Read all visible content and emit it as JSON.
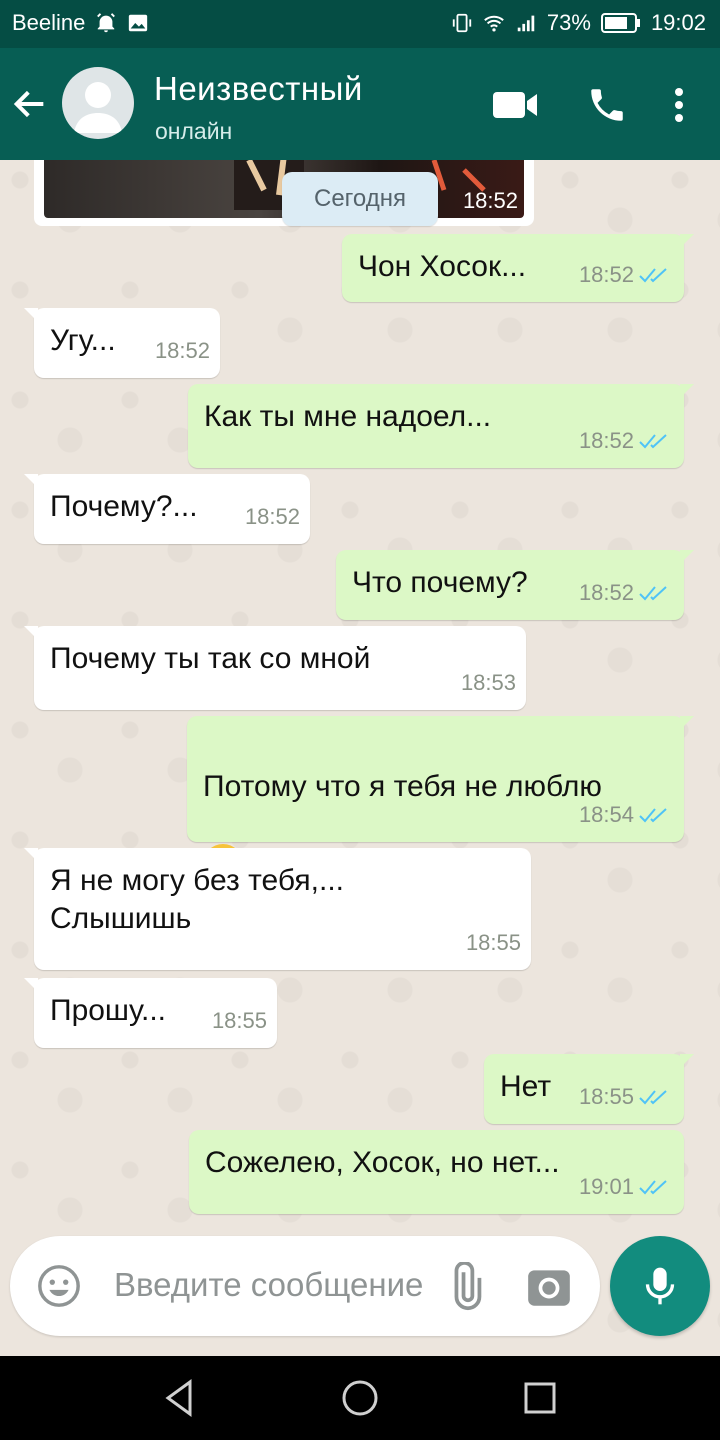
{
  "status_bar": {
    "carrier": "Beeline",
    "battery": "73%",
    "time": "19:02"
  },
  "header": {
    "contact_name": "Неизвестный",
    "status": "онлайн"
  },
  "chat": {
    "photo_time": "18:52",
    "date_label": "Сегодня",
    "messages": [
      {
        "dir": "out",
        "text": "Чон Хосок...",
        "time": "18:52",
        "read": true
      },
      {
        "dir": "in",
        "text": "Угу...",
        "time": "18:52"
      },
      {
        "dir": "out",
        "text": "Как ты мне надоел...",
        "time": "18:52",
        "read": true
      },
      {
        "dir": "in",
        "text": "Почему?...",
        "time": "18:52"
      },
      {
        "dir": "out",
        "text": "Что почему?",
        "time": "18:52",
        "read": true
      },
      {
        "dir": "in",
        "text": "Почему ты так со мной",
        "time": "18:53"
      },
      {
        "dir": "out",
        "text": "Потому что я тебя не люблю",
        "time": "18:54",
        "read": true,
        "emoji": "unamused-face"
      },
      {
        "dir": "in",
        "text": "Я не могу без тебя,...\nСлышишь",
        "time": "18:55"
      },
      {
        "dir": "in",
        "text": "Прошу...",
        "time": "18:55"
      },
      {
        "dir": "out",
        "text": "Нет",
        "time": "18:55",
        "read": true
      },
      {
        "dir": "out",
        "text": "Сожелею, Хосок, но нет...",
        "time": "19:01",
        "read": true
      }
    ]
  },
  "input": {
    "placeholder": "Введите сообщение"
  },
  "colors": {
    "header": "#075e54",
    "status_bar": "#054d44",
    "outgoing_bubble": "#dcf8c6",
    "incoming_bubble": "#ffffff",
    "read_ticks": "#4fc3f7",
    "mic_button": "#128c7e"
  },
  "icons": {
    "status_left": [
      "alarm-icon",
      "image-icon"
    ],
    "status_right": [
      "vibrate-icon",
      "wifi-icon",
      "signal-icon",
      "battery-icon"
    ],
    "header": [
      "back-arrow-icon",
      "video-call-icon",
      "phone-icon",
      "more-options-icon"
    ],
    "input": [
      "emoji-icon",
      "attach-icon",
      "camera-icon",
      "mic-icon"
    ],
    "nav": [
      "back-triangle-icon",
      "home-circle-icon",
      "recents-square-icon"
    ]
  }
}
